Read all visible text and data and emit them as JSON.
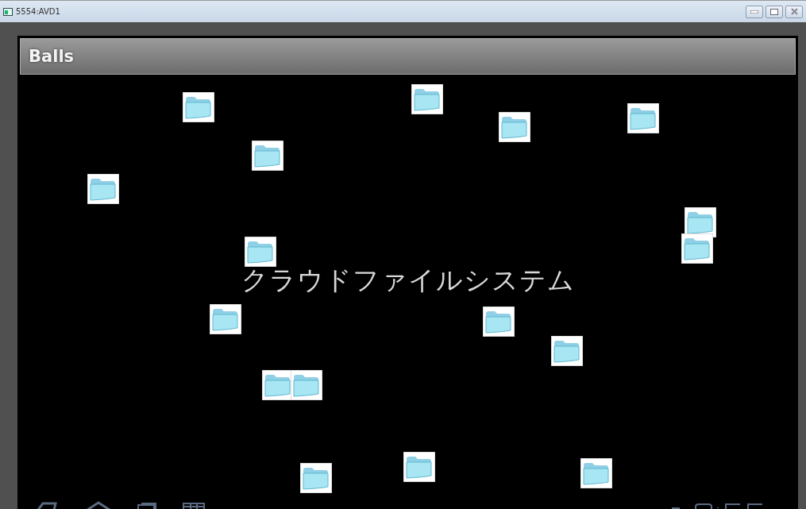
{
  "window": {
    "title": "5554:AVD1"
  },
  "action_bar": {
    "title": "Balls"
  },
  "canvas": {
    "caption": "クラウドファイルシステム"
  }
}
